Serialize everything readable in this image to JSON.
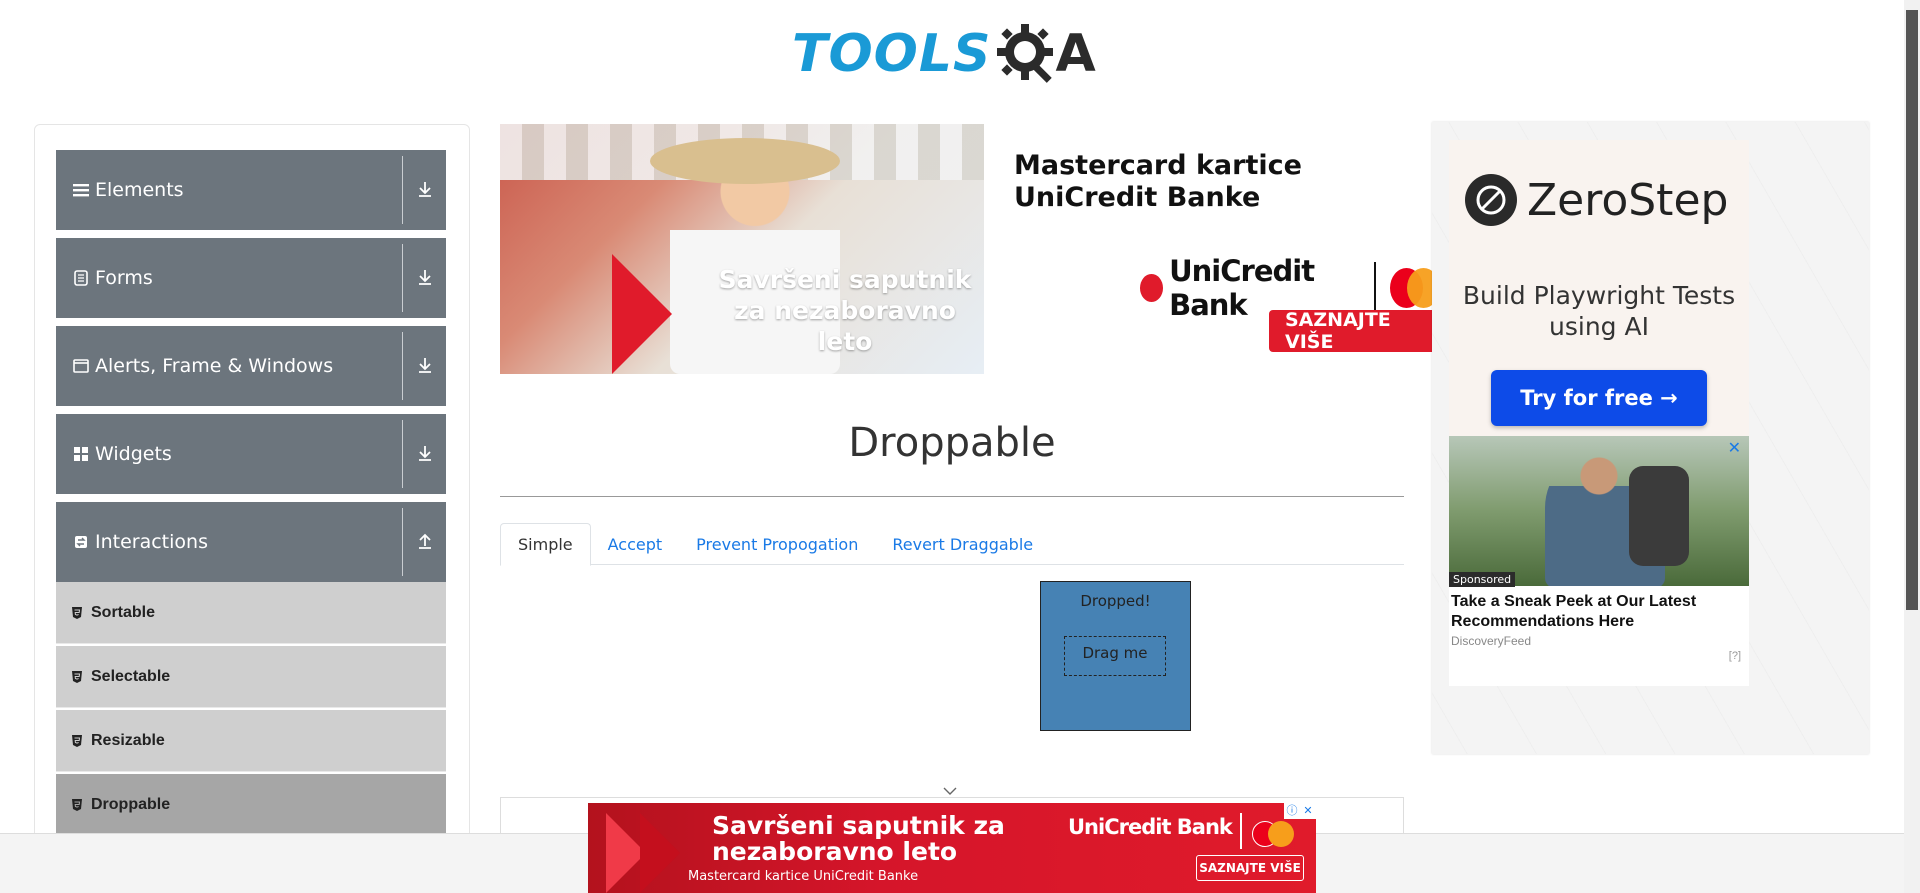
{
  "header": {
    "logo_text": "TOOLS",
    "logo_letter": "A"
  },
  "sidebar": {
    "groups": [
      {
        "label": "Elements",
        "icon": "hamburger-icon"
      },
      {
        "label": "Forms",
        "icon": "document-icon"
      },
      {
        "label": "Alerts, Frame & Windows",
        "icon": "window-icon"
      },
      {
        "label": "Widgets",
        "icon": "grid-icon"
      },
      {
        "label": "Interactions",
        "icon": "swap-icon"
      }
    ],
    "items": [
      {
        "label": "Sortable"
      },
      {
        "label": "Selectable"
      },
      {
        "label": "Resizable"
      },
      {
        "label": "Droppable",
        "active": true
      }
    ]
  },
  "banner": {
    "photo_text": "Savršeni saputnik za nezaboravno leto",
    "headline": "Mastercard kartice UniCredit Banke",
    "bank": "UniCredit Bank",
    "cta": "SAZNAJTE VIŠE"
  },
  "main": {
    "title": "Droppable",
    "tabs": [
      {
        "label": "Simple",
        "active": true
      },
      {
        "label": "Accept"
      },
      {
        "label": "Prevent Propogation"
      },
      {
        "label": "Revert Draggable"
      }
    ],
    "drop_box_text": "Dropped!",
    "drag_text": "Drag me"
  },
  "right_ad": {
    "brand": "ZeroStep",
    "tagline": "Build Playwright Tests using AI",
    "button": "Try for free →",
    "feed_sponsored": "Sponsored",
    "feed_title": "Take a Sneak Peek at Our Latest Recommendations Here",
    "feed_source": "DiscoveryFeed",
    "feed_close": "✕",
    "feed_adchoice": "[?]"
  },
  "bottom_ad": {
    "headline": "Savršeni saputnik za nezaboravno leto",
    "subline": "Mastercard kartice UniCredit Banke",
    "bank": "UniCredit Bank",
    "cta": "SAZNAJTE VIŠE",
    "info": "ⓘ",
    "close": "✕"
  },
  "colors": {
    "sidebar_group": "#6c757d",
    "sidebar_item": "#cfcfcf",
    "sidebar_active": "#a6a6a6",
    "drop_box": "#4682b4",
    "link": "#1a7ae6",
    "brand_blue": "#1a9ad6",
    "unicredit_red": "#e01b2b"
  }
}
